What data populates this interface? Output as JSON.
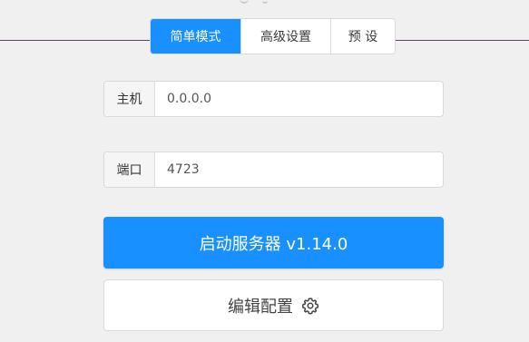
{
  "tabs": [
    {
      "label": "简单模式",
      "active": true
    },
    {
      "label": "高级设置",
      "active": false
    },
    {
      "label": "预 设",
      "active": false
    }
  ],
  "host": {
    "label": "主机",
    "value": "0.0.0.0"
  },
  "port": {
    "label": "端口",
    "value": "4723"
  },
  "start_button": {
    "label": "启动服务器 v1.14.0"
  },
  "edit_button": {
    "label": "编辑配置",
    "icon": "gear-icon"
  },
  "colors": {
    "accent": "#1890ff",
    "background": "#f0f0f0",
    "divider": "#6b3f64"
  }
}
